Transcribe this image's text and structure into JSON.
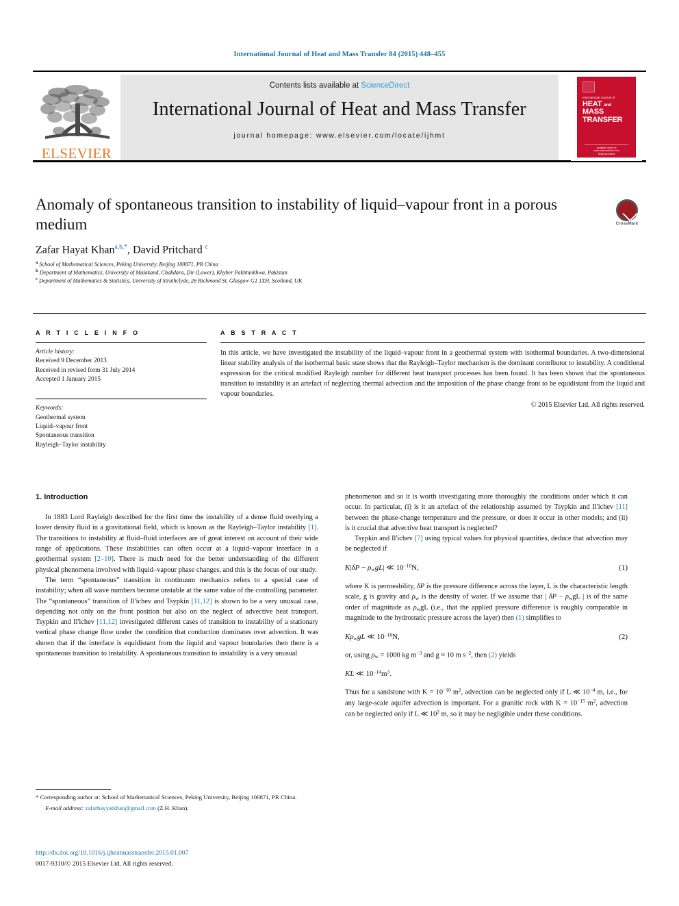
{
  "running_head": "International Journal of Heat and Mass Transfer 84 (2015) 448–455",
  "masthead": {
    "contents_prefix": "Contents lists available at ",
    "sciencedirect": "ScienceDirect",
    "journal_title": "International Journal of Heat and Mass Transfer",
    "homepage": "journal homepage: www.elsevier.com/locate/ijhmt",
    "publisher_logo_text": "ELSEVIER",
    "cover": {
      "superline": "International Journal of",
      "line1": "HEAT",
      "and": "and",
      "line2": "MASS",
      "line3": "TRANSFER",
      "footer_small": "Available online at www.sciencedirect.com",
      "footer_link": "ScienceDirect"
    },
    "accent_blue": "#2e9fd4",
    "elsevier_orange": "#E87722",
    "cover_red": "#c8102e"
  },
  "article": {
    "title": "Anomaly of spontaneous transition to instability of liquid–vapour front in a porous medium",
    "crossmark_label": "CrossMark",
    "authors_html": "Zafar Hayat Khan<sup>a,b,</sup><sup>*</sup>, David Pritchard <sup>c</sup>",
    "affiliations": [
      "School of Mathematical Sciences, Peking University, Beijing 100871, PR China",
      "Department of Mathematics, University of Malakand, Chakdara, Dir (Lower), Khyber Pakhtunkhwa, Pakistan",
      "Department of Mathematics & Statistics, University of Strathclyde, 26 Richmond St, Glasgow G1 1XH, Scotland, UK"
    ],
    "affiliation_marks": [
      "a",
      "b",
      "c"
    ]
  },
  "info": {
    "heading": "A R T I C L E    I N F O",
    "history_label": "Article history:",
    "history": [
      "Received 9 December 2013",
      "Received in revised form 31 July 2014",
      "Accepted 1 January 2015"
    ],
    "keywords_label": "Keywords:",
    "keywords": [
      "Geothermal system",
      "Liquid–vapour front",
      "Spontaneous transition",
      "Rayleigh–Taylor instability"
    ]
  },
  "abstract": {
    "heading": "A B S T R A C T",
    "text": "In this article, we have investigated the instability of the liquid–vapour front in a geothermal system with isothermal boundaries. A two-dimensional linear stability analysis of the isothermal basic state shows that the Rayleigh–Taylor mechanism is the dominant contributor to instability. A conditional expression for the critical modified Rayleigh number for different heat transport processes has been found. It has been shown that the spontaneous transition to instability is an artefact of neglecting thermal advection and the imposition of the phase change front to be equidistant from the liquid and vapour boundaries.",
    "copyright": "© 2015 Elsevier Ltd. All rights reserved."
  },
  "body": {
    "section_heading": "1. Introduction",
    "left_paragraphs": [
      "In 1883 Lord Rayleigh described for the first time the instability of a dense fluid overlying a lower density fluid in a gravitational field, which is known as the Rayleigh–Taylor instability [1]. The transitions to instability at fluid–fluid interfaces are of great interest on account of their wide range of applications. These instabilities can often occur at a liquid–vapour interface in a geothermal system [2–10]. There is much need for the better understanding of the different physical phenomena involved with liquid–vapour phase changes, and this is the focus of our study.",
      "The term “spontaneous” transition in continuum mechanics refers to a special case of instability; when all wave numbers become unstable at the same value of the controlling parameter. The “spontaneous” transition of Il'ichev and Tsypkin [11,12] is shown to be a very unusual case, depending not only on the front position but also on the neglect of advective heat transport. Tsypkin and Il'ichev [11,12] investigated different cases of transition to instability of a stationary vertical phase change flow under the condition that conduction dominates over advection. It was shown that if the interface is equidistant from the liquid and vapour boundaries then there is a spontaneous transition to instability. A spontaneous transition to instability is a very unusual"
    ],
    "right_paragraphs": [
      "phenomenon and so it is worth investigating more thoroughly the conditions under which it can occur. In particular, (i) is it an artefact of the relationship assumed by Tsypkin and Il'ichev [11] between the phase-change temperature and the pressure, or does it occur in other models; and (ii) is it crucial that advective heat transport is neglected?",
      "Tsypkin and Il'ichev [7] using typical values for physical quantities, deduce that advection may be neglected if"
    ],
    "citations": {
      "c1": "[1]",
      "c2_10": "[2–10]",
      "c11_12": "[11,12]",
      "c11": "[11]",
      "c7": "[7]",
      "eq1_ref": "(1)",
      "eq2_ref": "(2)"
    },
    "equations": [
      {
        "id": "eq1",
        "number": "(1)",
        "text": "K|δP − ρwgL| ≪ 10⁻¹⁰N,"
      },
      {
        "id": "eq2",
        "number": "(2)",
        "text": "KρwgL ≪ 10⁻¹⁰N,"
      },
      {
        "id": "eq3",
        "number": "",
        "text": "KL ≪ 10⁻¹⁴m³."
      }
    ],
    "right_after_eq1": "where K is permeability, δP is the pressure difference across the layer, L is the characteristic length scale, g is gravity and ρw is the density of water. If we assume that | δP − ρwgL | is of the same order of magnitude as ρwgL (i.e., that the applied pressure difference is roughly comparable in magnitude to the hydrostatic pressure across the layer) then (1) simplifies to",
    "right_after_eq2": "or, using ρw = 1000 kg m⁻³ and g ≈ 10 m s⁻², then (2) yields",
    "right_last": "Thus for a sandstone with K = 10⁻¹⁰ m², advection can be neglected only if L ≪ 10⁻⁴ m, i.e., for any large-scale aquifer advection is important. For a granitic rock with K = 10⁻¹⁵ m², advection can be neglected only if L ≪ 10² m, so it may be negligible under these conditions."
  },
  "footnotes": {
    "corresponding": "* Corresponding author at: School of Mathematical Sciences, Peking University, Beijing 100871, PR China.",
    "email_label": "E-mail address:",
    "email": "zafarhayyatkhan@gmail.com",
    "email_suffix": "(Z.H. Khan).",
    "doi": "http://dx.doi.org/10.1016/j.ijheatmasstransfer.2015.01.007",
    "issn": "0017-9310/© 2015 Elsevier Ltd. All rights reserved."
  }
}
